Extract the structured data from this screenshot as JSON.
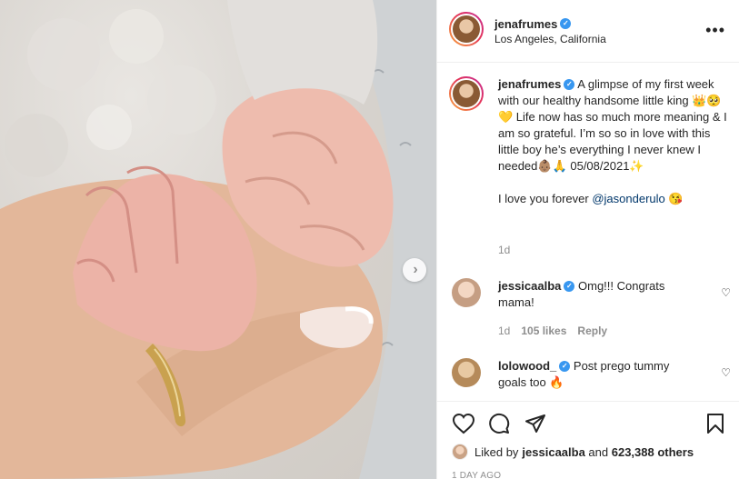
{
  "post": {
    "author": "jenafrumes",
    "location": "Los Angeles, California",
    "more_label": "•••",
    "verified_mark": "✓"
  },
  "caption": {
    "username": "jenafrumes",
    "text_1": " A glimpse of my first week with our healthy handsome little king 👑🥺💛 Life now has so much more meaning & I am so grateful. I’m so so in love with this little boy he’s everything I never knew I needed👶🏽🙏 05/08/2021✨",
    "text_2": "I love you forever ",
    "mention": "@jasonderulo",
    "text_2_end": " 😘",
    "age": "1d"
  },
  "comments": [
    {
      "username": "jessicaalba",
      "text": " Omg!!! Congrats mama!",
      "age": "1d",
      "likes": "105 likes",
      "reply_label": "Reply"
    },
    {
      "username": "lolowood_",
      "text": " Post prego tummy goals too 🔥"
    }
  ],
  "footer": {
    "liked_by_prefix": "Liked by ",
    "liked_by_user": "jessicaalba",
    "liked_by_middle": " and ",
    "liked_by_count": "623,388 others",
    "time_ago": "1 DAY AGO"
  },
  "colors": {
    "verified": "#3897f0",
    "mention": "#00376b",
    "muted": "#8e8e8e"
  },
  "icons": {
    "next": "chevron-right-icon",
    "like": "heart-icon",
    "comment": "comment-bubble-icon",
    "share": "paper-plane-icon",
    "save": "bookmark-icon",
    "more": "more-horizontal-icon"
  }
}
